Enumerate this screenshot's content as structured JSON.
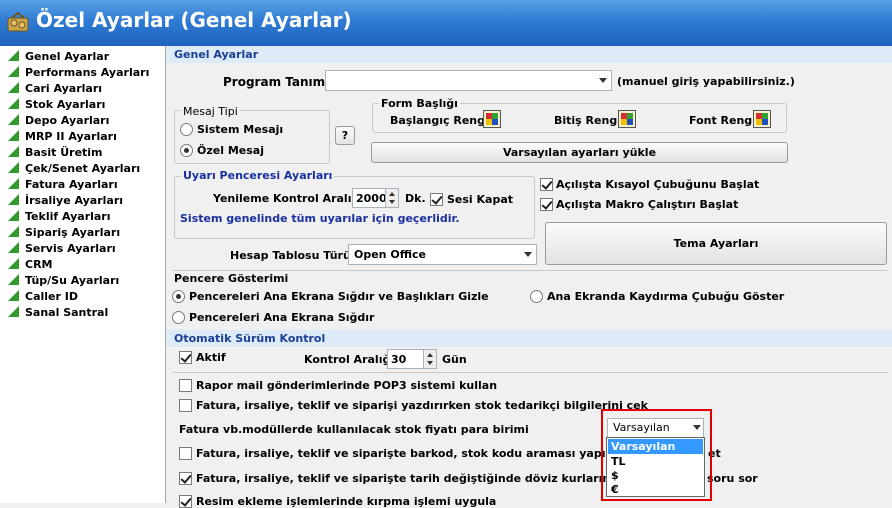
{
  "window": {
    "title": "Özel Ayarlar (Genel Ayarlar)"
  },
  "sidebar": {
    "items": [
      {
        "label": "Genel Ayarlar"
      },
      {
        "label": "Performans Ayarları"
      },
      {
        "label": "Cari Ayarları"
      },
      {
        "label": "Stok Ayarları"
      },
      {
        "label": "Depo Ayarları"
      },
      {
        "label": "MRP II Ayarları"
      },
      {
        "label": "Basit Üretim"
      },
      {
        "label": "Çek/Senet Ayarları"
      },
      {
        "label": "Fatura Ayarları"
      },
      {
        "label": "İrsaliye Ayarları"
      },
      {
        "label": "Teklif Ayarları"
      },
      {
        "label": "Sipariş Ayarları"
      },
      {
        "label": "Servis Ayarları"
      },
      {
        "label": "CRM"
      },
      {
        "label": "Tüp/Su Ayarları"
      },
      {
        "label": "Caller ID"
      },
      {
        "label": "Sanal Santral"
      }
    ]
  },
  "general": {
    "header": "Genel Ayarlar",
    "program_label": "Program Tanımı",
    "program_value": "",
    "program_hint": "(manuel giriş yapabilirsiniz.)",
    "mesaj_tipi": "Mesaj Tipi",
    "sistem_mesaji": "Sistem Mesajı",
    "ozel_mesaj": "Özel Mesaj",
    "help": "?",
    "form_basligi": "Form Başlığı",
    "baslangic_rengi": "Başlangıç Rengi",
    "bitis_rengi": "Bitiş Rengi",
    "font_rengi": "Font Rengi",
    "defaults_button": "Varsayılan ayarları yükle"
  },
  "uyari": {
    "title": "Uyarı Penceresi Ayarları",
    "yenileme_label": "Yenileme Kontrol Aralığı",
    "yenileme_value": "2000",
    "unit": "Dk.",
    "sesi_kapat": "Sesi Kapat",
    "note": "Sistem genelinde tüm uyarılar için geçerlidir."
  },
  "startup": {
    "kisayol": "Açılışta Kısayol Çubuğunu Başlat",
    "makro": "Açılışta Makro Çalıştırı Başlat"
  },
  "hesap": {
    "label": "Hesap Tablosu Türü",
    "value": "Open Office"
  },
  "tema_button": "Tema Ayarları",
  "pencere": {
    "header": "Pencere Gösterimi",
    "opt1": "Pencereleri Ana Ekrana Sığdır ve Başlıkları Gizle",
    "opt2": "Ana Ekranda Kaydırma Çubuğu Göster",
    "opt3": "Pencereleri Ana Ekrana Sığdır"
  },
  "surum": {
    "header": "Otomatik Sürüm Kontrol",
    "aktif": "Aktif",
    "interval_label": "Kontrol Aralığı",
    "interval_value": "30",
    "unit": "Gün"
  },
  "options": {
    "pop3": "Rapor mail gönderimlerinde POP3 sistemi kullan",
    "tedarikci": "Fatura, irsaliye, teklif ve siparişi yazdırırken stok tedarikçi bilgilerini çek",
    "stok_fiyati_label": "Fatura vb.modüllerde kullanılacak stok fiyatı para birimi",
    "stok_fiyati_value": "Varsayılan",
    "barkod": "Fatura, irsaliye, teklif ve siparişte barkod, stok kodu araması yapılırken",
    "barkod_end": "et",
    "doviz": "Fatura, irsaliye, teklif ve siparişte tarih değiştiğinde döviz kurlarını yenide",
    "doviz_end": "soru sor",
    "resim": "Resim ekleme işlemlerinde kırpma işlemi uygula"
  },
  "currency_dropdown": {
    "options": [
      "Varsayılan",
      "TL",
      "$",
      "€"
    ],
    "selected": "Varsayılan"
  },
  "colors": {
    "title_bar": "#2f7bd3",
    "section_header": "#ddeaf8",
    "highlight": "#e00000",
    "selection": "#3399ff"
  }
}
